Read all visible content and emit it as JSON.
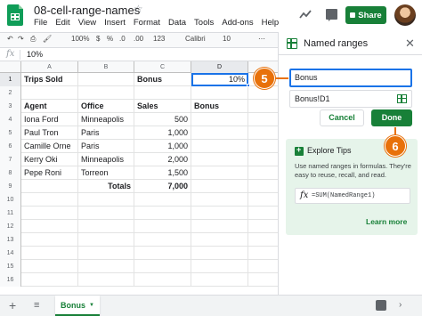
{
  "app": {
    "doc_title": "08-cell-range-names",
    "menu": [
      "File",
      "Edit",
      "View",
      "Insert",
      "Format",
      "Data",
      "Tools",
      "Add-ons",
      "Help"
    ],
    "share_label": "Share"
  },
  "toolbar": {
    "zoom": "100%",
    "currency": "$",
    "percent": "%",
    "dec_decrease": ".0",
    "dec_increase": ".00",
    "number_format": "123",
    "font": "Calibri",
    "font_size": "10"
  },
  "formula_bar": {
    "fx": "fx",
    "value": "10%"
  },
  "grid": {
    "columns": [
      "A",
      "B",
      "C",
      "D"
    ],
    "selected_column": "D",
    "selected_row": "1",
    "rows": [
      {
        "num": "1",
        "cells": [
          "Trips Sold",
          "",
          "Bonus",
          "10%"
        ]
      },
      {
        "num": "2",
        "cells": [
          "",
          "",
          "",
          ""
        ]
      },
      {
        "num": "3",
        "cells": [
          "Agent",
          "Office",
          "Sales",
          "Bonus"
        ]
      },
      {
        "num": "4",
        "cells": [
          "Iona Ford",
          "Minneapolis",
          "500",
          ""
        ]
      },
      {
        "num": "5",
        "cells": [
          "Paul Tron",
          "Paris",
          "1,000",
          ""
        ]
      },
      {
        "num": "6",
        "cells": [
          "Camille Orne",
          "Paris",
          "1,000",
          ""
        ]
      },
      {
        "num": "7",
        "cells": [
          "Kerry Oki",
          "Minneapolis",
          "2,000",
          ""
        ]
      },
      {
        "num": "8",
        "cells": [
          "Pepe Roni",
          "Torreon",
          "1,500",
          ""
        ]
      },
      {
        "num": "9",
        "cells": [
          "",
          "Totals",
          "7,000",
          ""
        ]
      },
      {
        "num": "10",
        "cells": [
          "",
          "",
          "",
          ""
        ]
      },
      {
        "num": "11",
        "cells": [
          "",
          "",
          "",
          ""
        ]
      },
      {
        "num": "12",
        "cells": [
          "",
          "",
          "",
          ""
        ]
      },
      {
        "num": "13",
        "cells": [
          "",
          "",
          "",
          ""
        ]
      },
      {
        "num": "14",
        "cells": [
          "",
          "",
          "",
          ""
        ]
      },
      {
        "num": "15",
        "cells": [
          "",
          "",
          "",
          ""
        ]
      },
      {
        "num": "16",
        "cells": [
          "",
          "",
          "",
          ""
        ]
      }
    ]
  },
  "sheet_tabs": {
    "active": "Bonus"
  },
  "panel": {
    "title": "Named ranges",
    "name_value": "Bonus",
    "range_value": "Bonus!D1",
    "cancel_label": "Cancel",
    "done_label": "Done",
    "tips": {
      "title": "Explore Tips",
      "text": "Use named ranges in formulas. They're easy to reuse, recall, and read.",
      "formula": "=SUM(NamedRange1)",
      "learn_more": "Learn more"
    }
  },
  "callouts": [
    "5",
    "6"
  ],
  "colors": {
    "accent_green": "#188038",
    "selection_blue": "#1a73e8",
    "callout_orange": "#e8710a"
  }
}
